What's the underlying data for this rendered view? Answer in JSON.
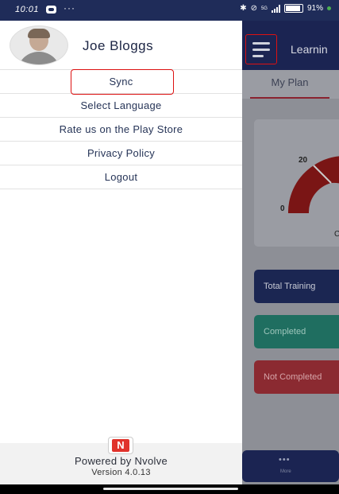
{
  "status_bar": {
    "time": "10:01",
    "battery": "91%",
    "more_dots": "···",
    "network": "5G"
  },
  "drawer": {
    "user_name": "Joe Bloggs",
    "menu_items": [
      {
        "label": "Sync",
        "highlighted": true
      },
      {
        "label": "Select Language"
      },
      {
        "label": "Rate us on the Play Store"
      },
      {
        "label": "Privacy Policy"
      },
      {
        "label": "Logout"
      }
    ],
    "footer": {
      "logo_letter": "N",
      "powered_by": "Powered by Nvolve",
      "version": "Version 4.0.13"
    }
  },
  "background_app": {
    "title": "Learnin",
    "tab": "My Plan",
    "gauge_labels": [
      "20",
      "0",
      "C"
    ],
    "stats": {
      "total": "Total Training",
      "completed": "Completed",
      "not_completed": "Not Completed"
    },
    "bottom_nav": {
      "dots": "•••",
      "label": "More"
    },
    "accent_color": "#8b1d1d"
  },
  "icons": [
    "chat-icon",
    "bluetooth-icon",
    "mute-icon",
    "signal-icon",
    "battery-icon",
    "hamburger-menu-icon",
    "nvolve-logo-icon",
    "avatar-icon"
  ]
}
